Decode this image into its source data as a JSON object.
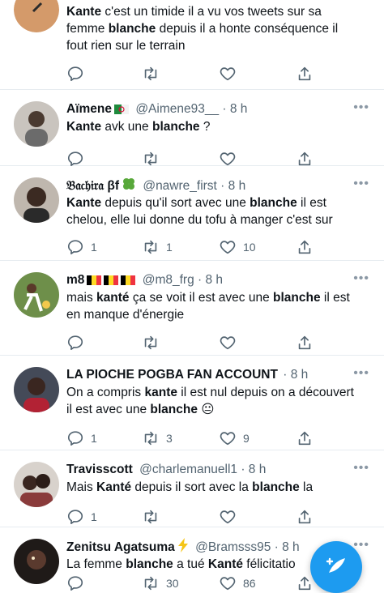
{
  "tweets": [
    {
      "name": "",
      "handle": "",
      "badges": [],
      "body": [
        {
          "t": "Kante",
          "b": true
        },
        {
          "t": " c'est un timide il a vu vos tweets sur sa femme ",
          "b": false
        },
        {
          "t": "blanche",
          "b": true
        },
        {
          "t": " depuis il a honte conséquence il fout rien sur le terrain",
          "b": false
        }
      ],
      "counts": {
        "reply": "",
        "retweet": "",
        "like": ""
      },
      "avatar_color": "#d49a6a"
    },
    {
      "name": "Aïmene",
      "handle": "@Aimene93__ · 8 h",
      "badges": [
        "algeria-flag-icon"
      ],
      "body": [
        {
          "t": "Kante",
          "b": true
        },
        {
          "t": " avk une ",
          "b": false
        },
        {
          "t": "blanche",
          "b": true
        },
        {
          "t": " ?",
          "b": false
        }
      ],
      "counts": {
        "reply": "",
        "retweet": "",
        "like": ""
      },
      "avatar_color": "#6b6b6b"
    },
    {
      "name": "𝔅𝔞𝔠𝔥𝔦𝔯𝔞 βf",
      "handle": "@nawre_first · 8 h",
      "badges": [
        "four-leaf-clover-icon"
      ],
      "body": [
        {
          "t": "Kante",
          "b": true
        },
        {
          "t": " depuis qu'il sort avec une ",
          "b": false
        },
        {
          "t": "blanche",
          "b": true
        },
        {
          "t": " il est chelou, elle lui donne du tofu à manger c'est sur",
          "b": false
        }
      ],
      "counts": {
        "reply": "1",
        "retweet": "1",
        "like": "10"
      },
      "avatar_color": "#3b2a22"
    },
    {
      "name": "m8",
      "handle": "@m8_frg · 8 h",
      "badges": [
        "belgium-flag-icon",
        "belgium-flag-icon",
        "belgium-flag-icon"
      ],
      "body": [
        {
          "t": "mais ",
          "b": false
        },
        {
          "t": "kanté",
          "b": true
        },
        {
          "t": " ça se voit il est avec une ",
          "b": false
        },
        {
          "t": "blanche",
          "b": true
        },
        {
          "t": " il est en manque d'énergie",
          "b": false
        }
      ],
      "counts": {
        "reply": "",
        "retweet": "",
        "like": ""
      },
      "avatar_color": "#4f7a3a"
    },
    {
      "name": "LA PIOCHE POGBA FAN ACCOUNT",
      "handle": "· 8 h",
      "badges": [],
      "body": [
        {
          "t": "On a compris ",
          "b": false
        },
        {
          "t": "kante",
          "b": true
        },
        {
          "t": " il est nul depuis on a découvert il est avec une ",
          "b": false
        },
        {
          "t": "blanche",
          "b": true
        },
        {
          "t": " 😐",
          "b": false
        }
      ],
      "counts": {
        "reply": "1",
        "retweet": "3",
        "like": "9"
      },
      "avatar_color": "#2a2a35"
    },
    {
      "name": "Travisscott",
      "handle": "@charlemanuell1 · 8 h",
      "badges": [],
      "body": [
        {
          "t": "Mais ",
          "b": false
        },
        {
          "t": "Kanté",
          "b": true
        },
        {
          "t": " depuis il sort avec la ",
          "b": false
        },
        {
          "t": "blanche",
          "b": true
        },
        {
          "t": " la",
          "b": false
        }
      ],
      "counts": {
        "reply": "1",
        "retweet": "",
        "like": ""
      },
      "avatar_color": "#8a3b3b"
    },
    {
      "name": "Zenitsu Agatsuma",
      "handle": "@Bramsss95 · 8 h",
      "badges": [
        "lightning-icon"
      ],
      "body": [
        {
          "t": "La femme ",
          "b": false
        },
        {
          "t": "blanche",
          "b": true
        },
        {
          "t": " a tué ",
          "b": false
        },
        {
          "t": "Kanté",
          "b": true
        },
        {
          "t": " félicitatio",
          "b": false
        }
      ],
      "counts": {
        "reply": "",
        "retweet": "30",
        "like": "86"
      },
      "avatar_color": "#3d2b24"
    }
  ],
  "more_label": "•••",
  "fab": {
    "icon": "compose-tweet-icon",
    "color": "#1d9bf0"
  },
  "colors": {
    "text": "#0f1419",
    "secondary": "#536471",
    "divider": "#e6ecf0"
  }
}
